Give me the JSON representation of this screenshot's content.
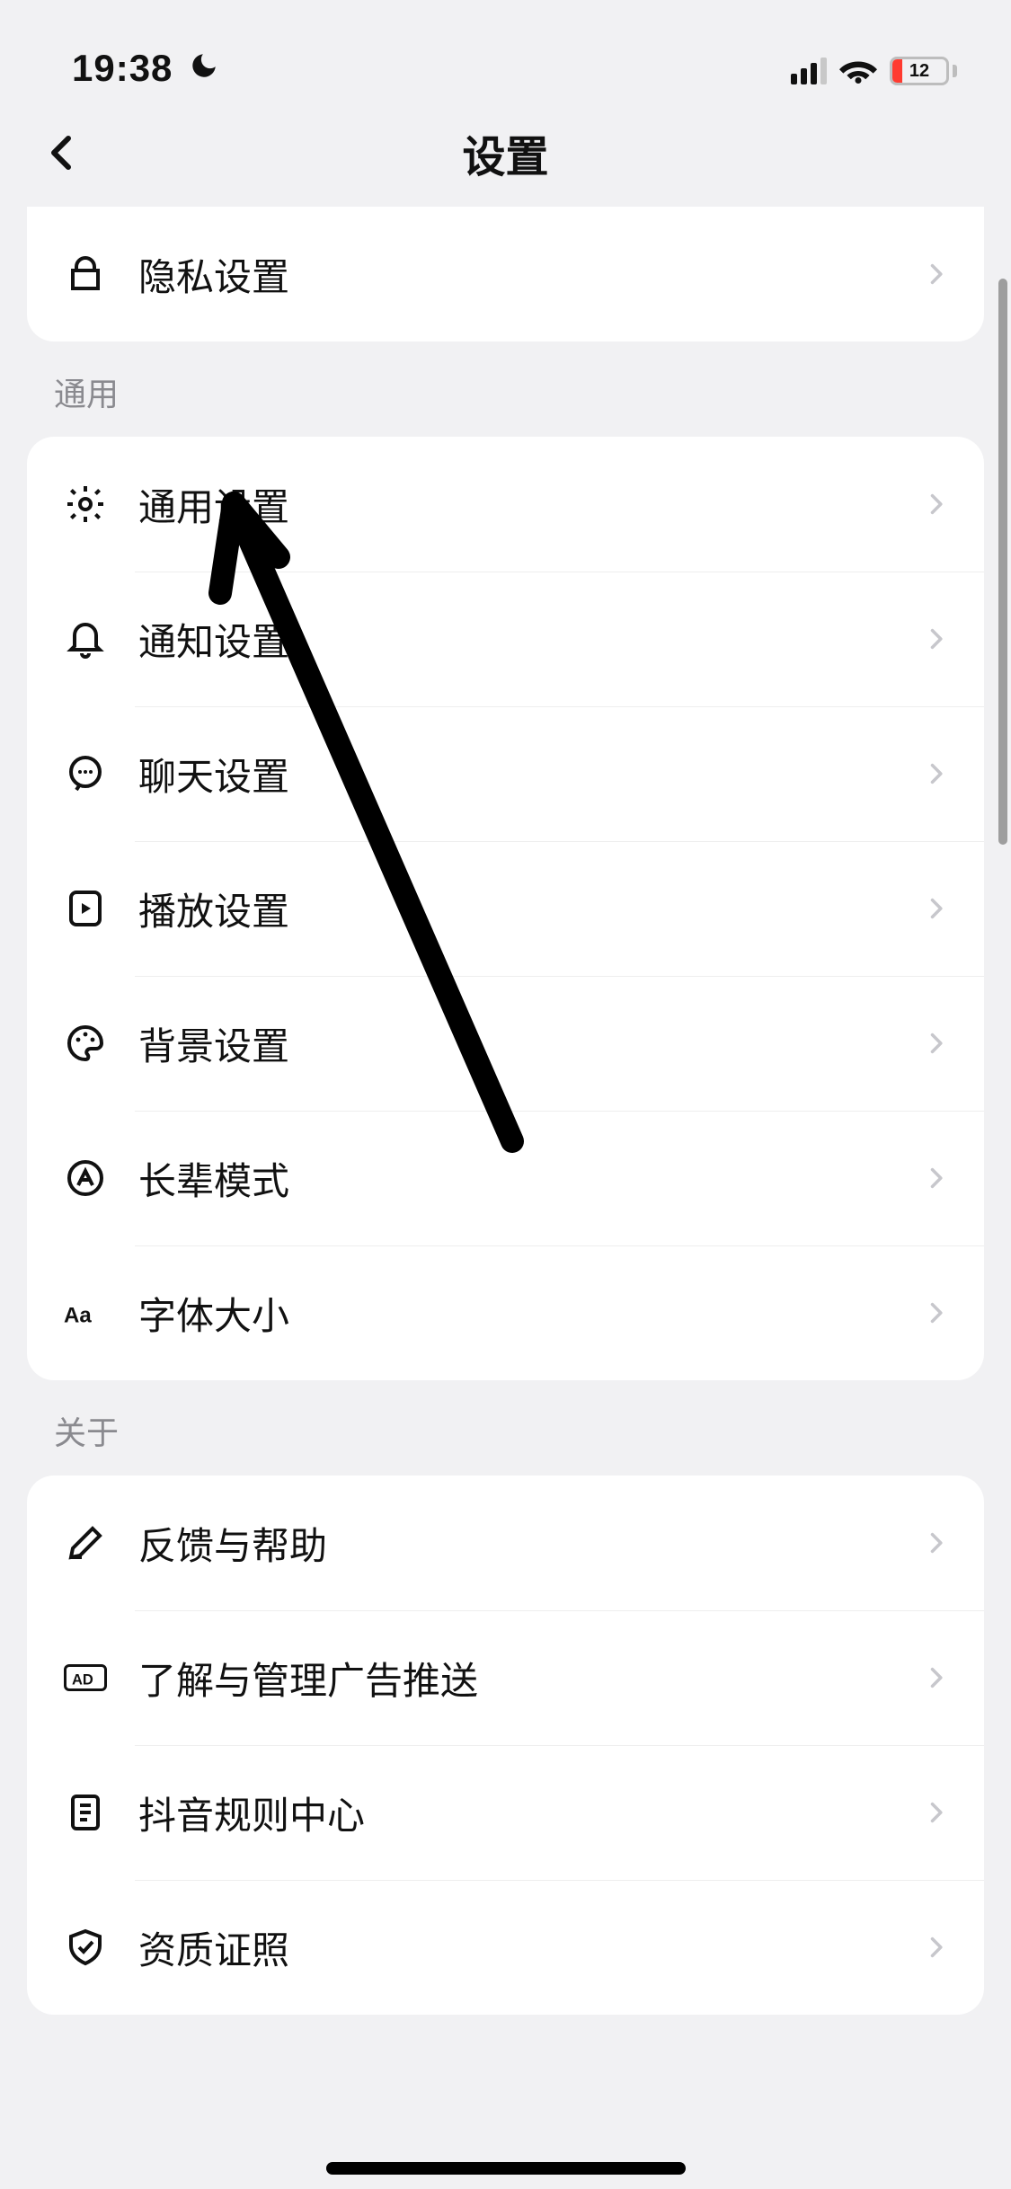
{
  "status": {
    "time": "19:38",
    "battery_pct": "12"
  },
  "header": {
    "title": "设置"
  },
  "group_top": {
    "items": [
      {
        "label": "隐私设置"
      }
    ]
  },
  "group_general": {
    "title": "通用",
    "items": [
      {
        "label": "通用设置"
      },
      {
        "label": "通知设置"
      },
      {
        "label": "聊天设置"
      },
      {
        "label": "播放设置"
      },
      {
        "label": "背景设置"
      },
      {
        "label": "长辈模式"
      },
      {
        "label": "字体大小"
      }
    ]
  },
  "group_about": {
    "title": "关于",
    "items": [
      {
        "label": "反馈与帮助"
      },
      {
        "label": "了解与管理广告推送"
      },
      {
        "label": "抖音规则中心"
      },
      {
        "label": "资质证照"
      }
    ]
  }
}
